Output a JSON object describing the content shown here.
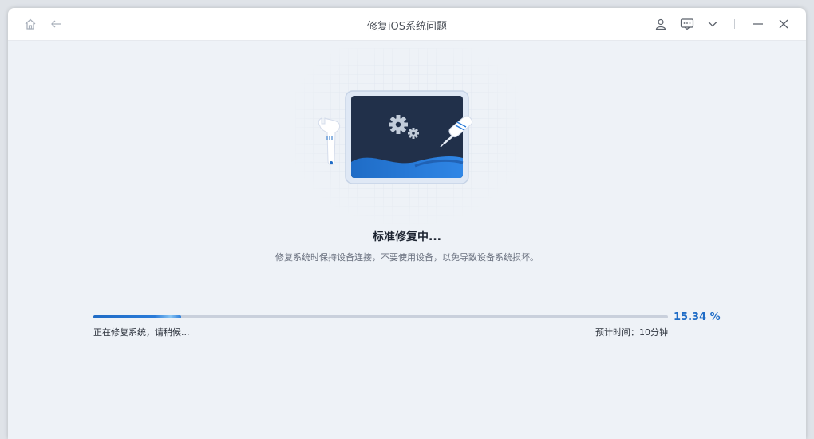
{
  "window": {
    "title": "修复iOS系统问题"
  },
  "titlebar": {
    "left_icons": [
      "home-icon",
      "back-arrow-icon"
    ],
    "right_icons": [
      "user-icon",
      "feedback-icon",
      "chevron-down-icon",
      "minimize-icon",
      "close-icon"
    ]
  },
  "main": {
    "heading": "标准修复中...",
    "subtext": "修复系统时保持设备连接，不要使用设备，以免导致设备系统损坏。"
  },
  "progress": {
    "percent": 15.34,
    "percent_label": "15.34 %",
    "status_left": "正在修复系统，请稍候...",
    "status_right": "预计时间：10分钟"
  },
  "colors": {
    "accent": "#1f6cc6",
    "screen_dark": "#21304a",
    "background": "#eef2f7"
  }
}
